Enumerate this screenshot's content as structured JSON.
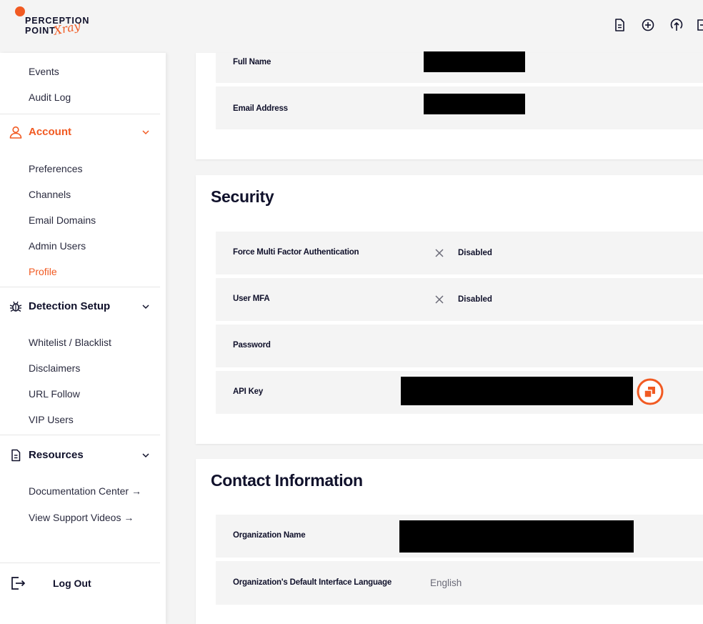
{
  "brand": {
    "line1": "PERCEPTION",
    "line2": "POINT",
    "script": "Xray",
    "accent_color": "#f15a22",
    "text_color": "#10112b"
  },
  "topbar": {
    "icons": [
      "document-icon",
      "add-circle-icon",
      "upload-icon",
      "export-icon"
    ]
  },
  "sidebar": {
    "items_top": [
      {
        "label": "Events"
      },
      {
        "label": "Audit Log"
      }
    ],
    "account": {
      "label": "Account",
      "items": [
        {
          "label": "Preferences"
        },
        {
          "label": "Channels"
        },
        {
          "label": "Email Domains"
        },
        {
          "label": "Admin Users"
        },
        {
          "label": "Profile",
          "active": true
        }
      ]
    },
    "detection": {
      "label": "Detection Setup",
      "items": [
        {
          "label": "Whitelist / Blacklist"
        },
        {
          "label": "Disclaimers"
        },
        {
          "label": "URL Follow"
        },
        {
          "label": "VIP Users"
        }
      ]
    },
    "resources": {
      "label": "Resources",
      "items": [
        {
          "label": "Documentation Center →"
        },
        {
          "label": "View Support Videos →"
        }
      ]
    },
    "logout": {
      "label": "Log Out"
    }
  },
  "profile": {
    "rows": [
      {
        "label": "Full Name"
      },
      {
        "label": "Email Address"
      }
    ]
  },
  "security": {
    "title": "Security",
    "rows": [
      {
        "label": "Force Multi Factor Authentication",
        "value": "Disabled"
      },
      {
        "label": "User MFA",
        "value": "Disabled"
      },
      {
        "label": "Password"
      },
      {
        "label": "API Key"
      }
    ]
  },
  "contact": {
    "title": "Contact Information",
    "rows": [
      {
        "label": "Organization Name"
      },
      {
        "label": "Organization's Default Interface Language",
        "value": "English"
      }
    ]
  }
}
